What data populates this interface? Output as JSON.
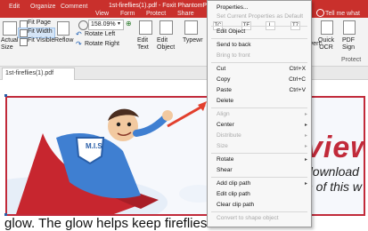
{
  "window_title": "1st-fireflies(1).pdf - Foxit PhantomPDF",
  "tell_me": "Tell me what",
  "menu_tabs": [
    "Edit",
    "Organize",
    "Comment",
    "View",
    "Form",
    "Protect",
    "Share"
  ],
  "ribbon": {
    "actual_size": "Actual Size",
    "fit_page": "Fit Page",
    "fit_width": "Fit Width",
    "fit_visible": "Fit Visible",
    "reflow": "Reflow",
    "zoom_value": "158.09%",
    "rotate_left": "Rotate Left",
    "rotate_right": "Rotate Right",
    "edit_text": "Edit Text",
    "edit_object": "Edit Object",
    "typewriter": "Typewr",
    "convert": "onvert",
    "quick_ocr": "Quick OCR",
    "pdf_sign": "PDF Sign",
    "protect_group": "Protect"
  },
  "doc_tab": "1st-fireflies(1).pdf",
  "page": {
    "banner_heading": "view",
    "banner_line1": "download",
    "banner_line2": "n of this w",
    "body_text": "glow.  The glow helps keep fireflies safe",
    "badge_letters": "M.I.S"
  },
  "context_menu": {
    "properties": "Properties...",
    "set_current": "Set Current Properties as Default",
    "quick_keys": [
      "TC",
      "TE",
      "L",
      "T7"
    ],
    "edit_object": "Edit Object",
    "send_to_back": "Send to back",
    "bring_to_front": "Bring to front",
    "cut": "Cut",
    "cut_sc": "Ctrl+X",
    "copy": "Copy",
    "copy_sc": "Ctrl+C",
    "paste": "Paste",
    "paste_sc": "Ctrl+V",
    "delete": "Delete",
    "align": "Align",
    "center": "Center",
    "distribute": "Distribute",
    "size": "Size",
    "rotate": "Rotate",
    "shear": "Shear",
    "add_clip": "Add clip path",
    "edit_clip": "Edit clip path",
    "clear_clip": "Clear clip path",
    "convert_shape": "Convert to shape object"
  },
  "colors": {
    "brand_red": "#c9302c",
    "menu_bg": "#f7f7f7",
    "highlight": "#d7e6f7",
    "arrow": "#e2402e"
  }
}
